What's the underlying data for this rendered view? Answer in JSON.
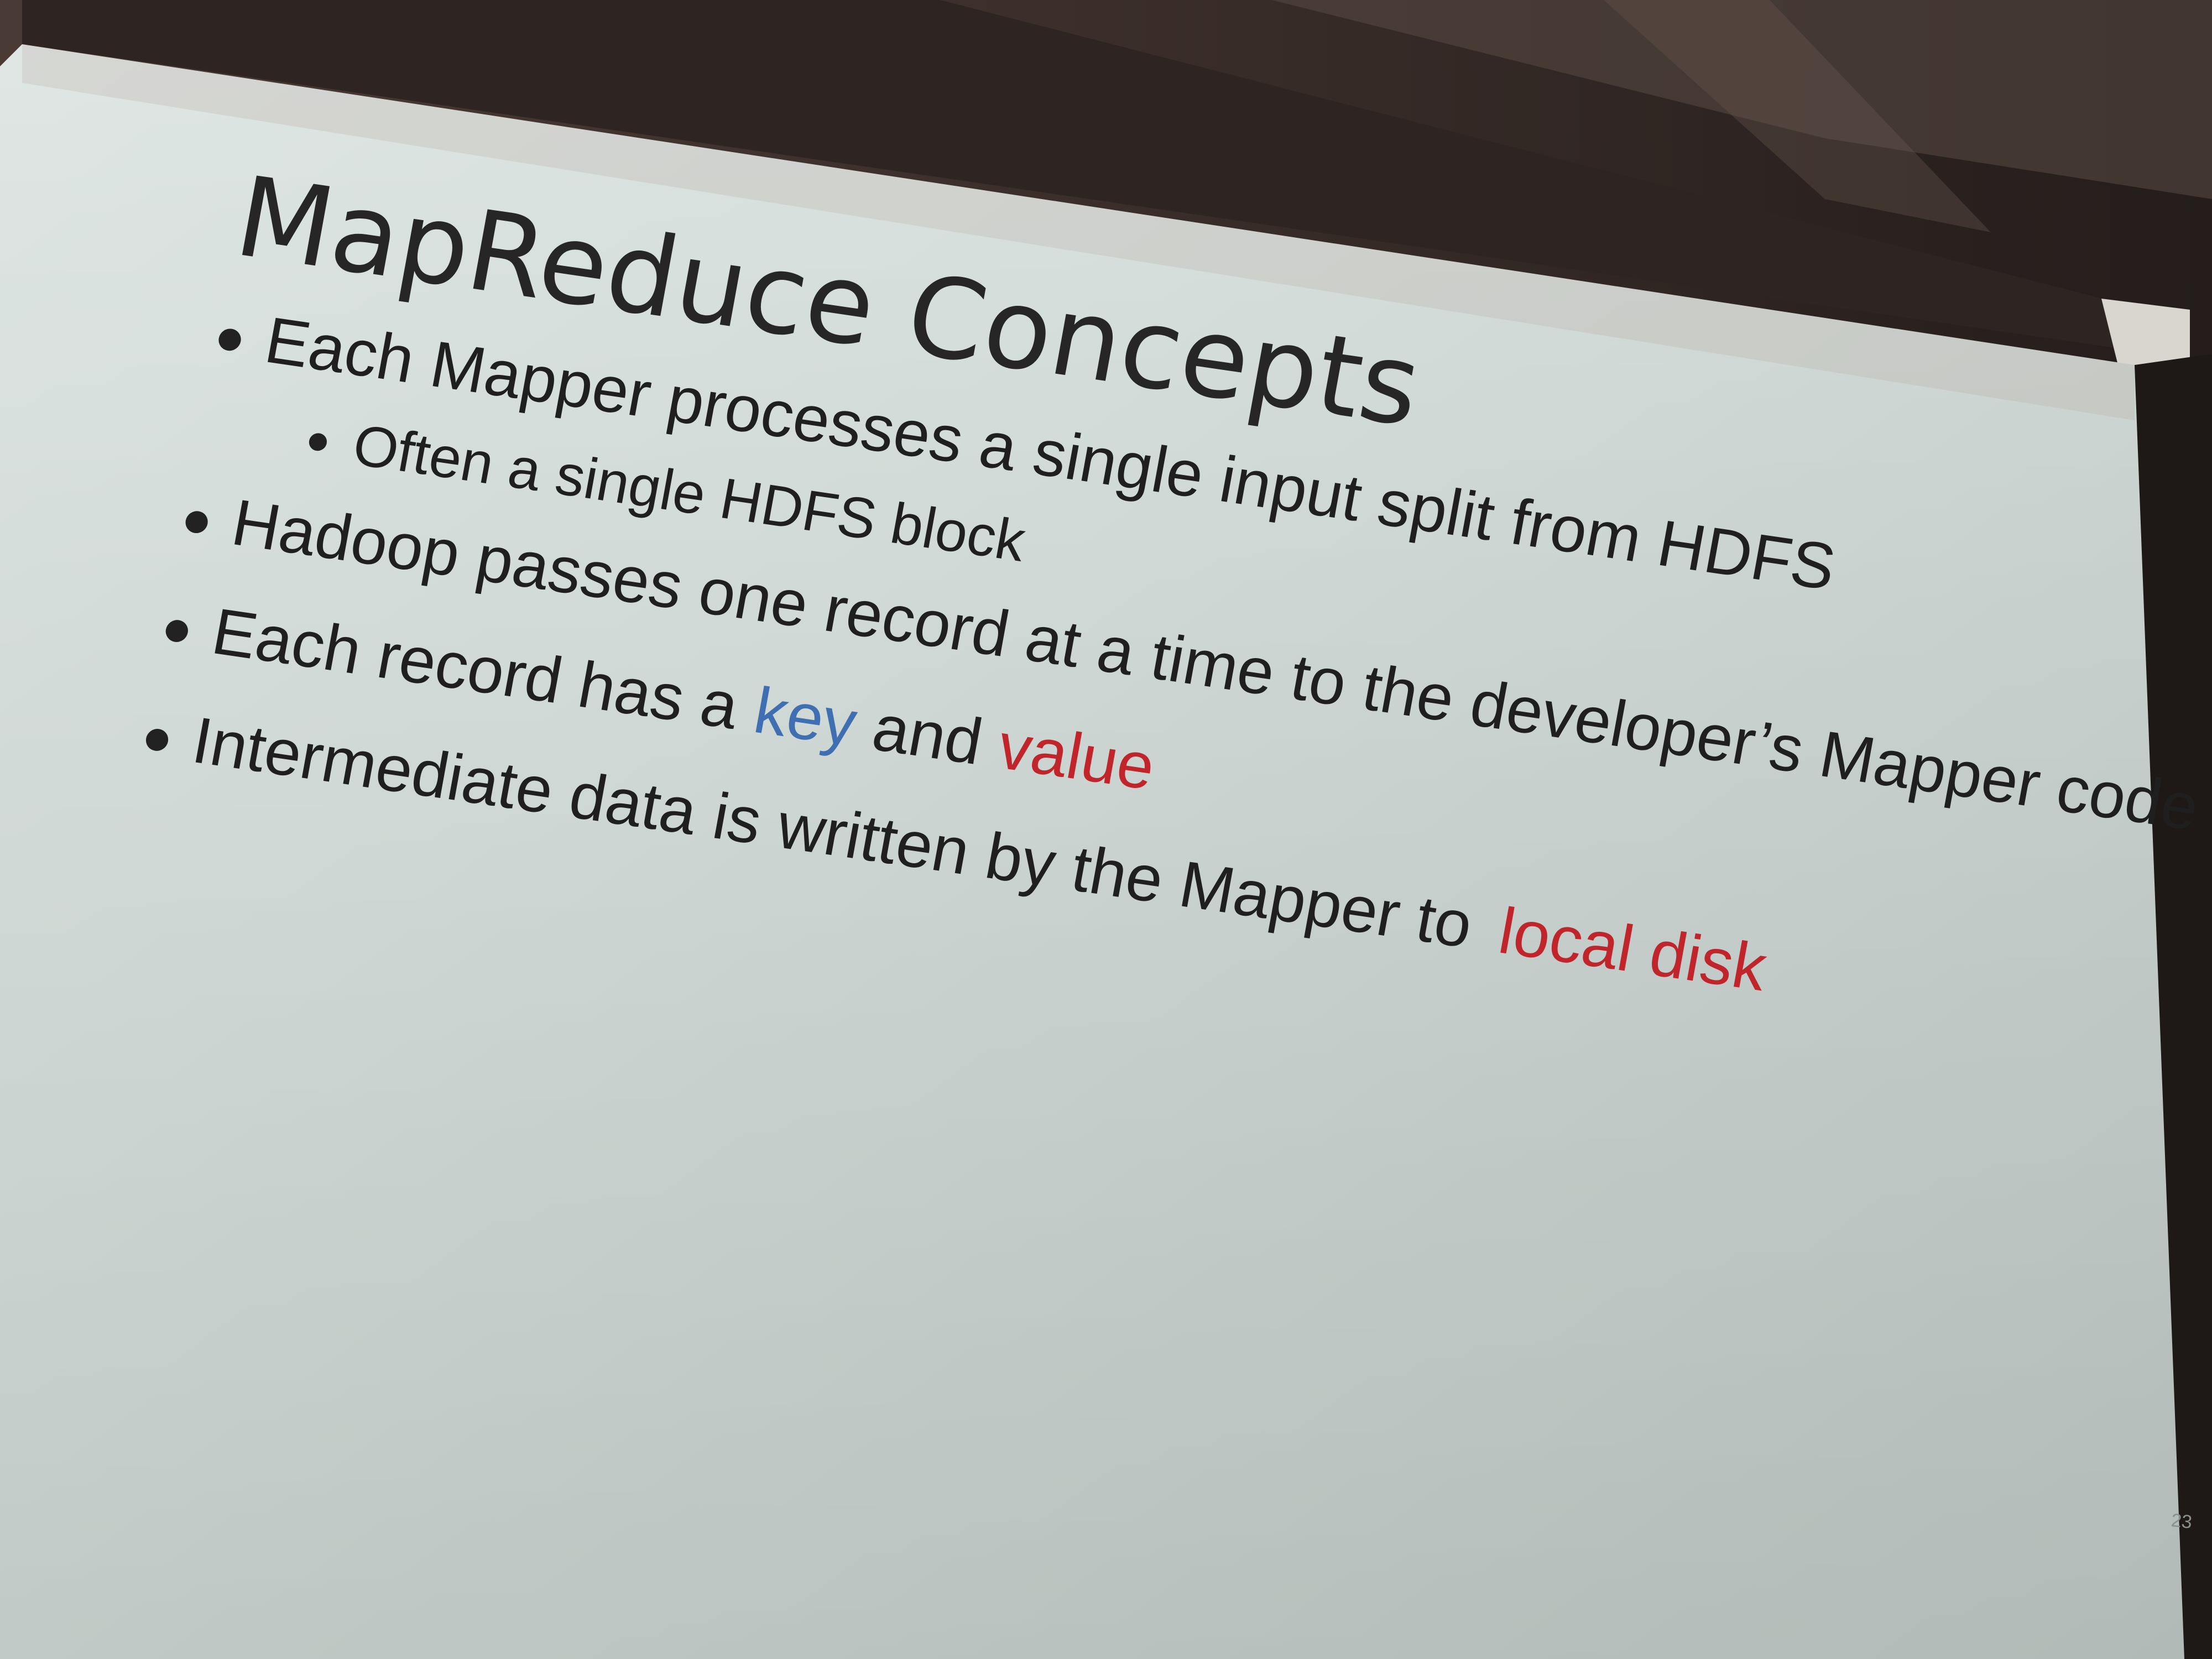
{
  "slide": {
    "title": "MapReduce Concepts",
    "bullets": [
      {
        "level": 1,
        "text": "Each Mapper processes a single input split from HDFS"
      },
      {
        "level": 2,
        "text": "Often a single HDFS block"
      },
      {
        "level": 1,
        "text": "Hadoop passes one record at a time to the developer’s Mapper code"
      },
      {
        "level": 1,
        "parts": [
          "Each record has a ",
          "key",
          " and ",
          "value"
        ]
      },
      {
        "level": 1,
        "parts": [
          "Intermediate data is written by the Mapper to ",
          "local disk"
        ]
      }
    ],
    "page_number": "23"
  },
  "colors": {
    "screen": "#d3dcd8",
    "text": "#1f1f1f",
    "key_blue": "#3f6fb0",
    "value_red": "#c0252b",
    "room": "#2b2420"
  }
}
